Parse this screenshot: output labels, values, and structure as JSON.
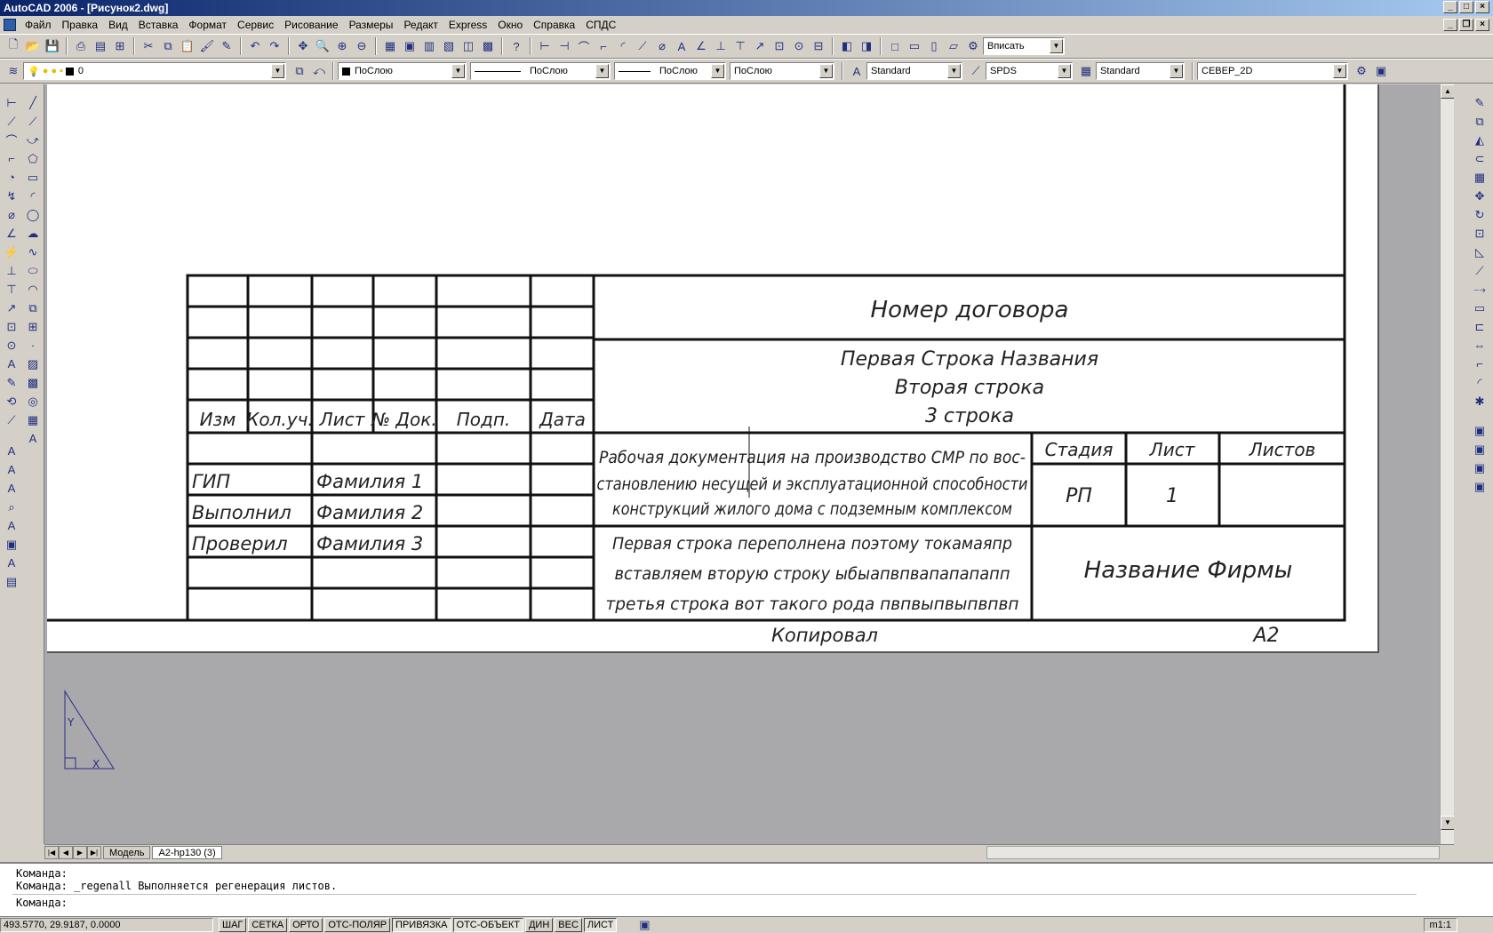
{
  "window": {
    "title": "AutoCAD 2006 - [Рисунок2.dwg]"
  },
  "menu": [
    "Файл",
    "Правка",
    "Вид",
    "Вставка",
    "Формат",
    "Сервис",
    "Рисование",
    "Размеры",
    "Редакт",
    "Express",
    "Окно",
    "Справка",
    "СПДС"
  ],
  "toolbar1": {
    "zoom_combo": "Вписать"
  },
  "toolbar2": {
    "layer": "0",
    "color": "ПоСлою",
    "linetype": "ПоСлою",
    "lineweight": "ПоСлою",
    "plotstyle": "ПоСлою",
    "textstyle": "Standard",
    "dimstyle": "SPDS",
    "tablestyle": "Standard",
    "view": "СЕВЕР_2D"
  },
  "titleblock": {
    "left_headers": [
      "Изм",
      "Кол.уч.",
      "Лист",
      "№ Док.",
      "Подп.",
      "Дата"
    ],
    "roles": [
      "ГИП",
      "Выполнил",
      "Проверил"
    ],
    "names": [
      "Фамилия 1",
      "Фамилия 2",
      "Фамилия 3"
    ],
    "contract": "Номер договора",
    "name_lines": [
      "Первая Строка Названия",
      "Вторая строка",
      "3 строка"
    ],
    "description_lines": [
      "Рабочая документация на производство СМР по вос-",
      "становлению несущей и эксплуатационной способности",
      "конструкций жилого дома с подземным комплексом"
    ],
    "stage_header": "Стадия",
    "sheet_header": "Лист",
    "sheets_header": "Листов",
    "stage": "РП",
    "sheet": "1",
    "sheets": "",
    "overflow_lines": [
      "Первая строка переполнена поэтому токамаяпр",
      "вставляем вторую строку ыбыапвпвапапапапп",
      "третья строка вот такого рода пвпвыпвыпвпвп"
    ],
    "company": "Название Фирмы",
    "copied": "Копировал",
    "format": "A2"
  },
  "tabs": [
    "Модель",
    "A2-hp130 (3)"
  ],
  "command": {
    "line1": "Команда:",
    "line2": "Команда: _regenall Выполняется регенерация листов.",
    "prompt": "Команда:"
  },
  "status": {
    "coords": "493.5770, 29.9187, 0.0000",
    "toggles": [
      "ШАГ",
      "СЕТКА",
      "ОРТО",
      "ОТС-ПОЛЯР",
      "ПРИВЯЗКА",
      "ОТС-ОБЪЕКТ",
      "ДИН",
      "ВЕС",
      "ЛИСТ"
    ],
    "scale": "m1:1"
  }
}
